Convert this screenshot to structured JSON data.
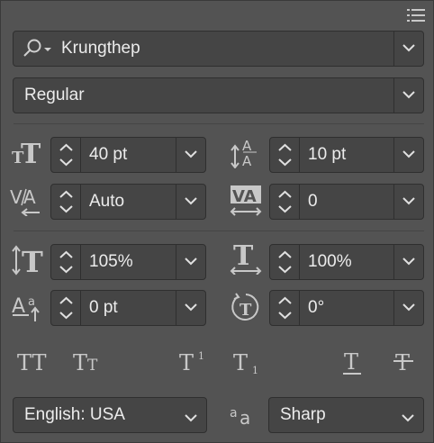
{
  "font_family": {
    "value": "Krungthep"
  },
  "font_style": {
    "value": "Regular"
  },
  "size": {
    "value": "40 pt"
  },
  "leading": {
    "value": "10 pt"
  },
  "kerning": {
    "value": "Auto"
  },
  "tracking": {
    "value": "0"
  },
  "vertical_scale": {
    "value": "105%"
  },
  "horizontal_scale": {
    "value": "100%"
  },
  "baseline_shift": {
    "value": "0 pt"
  },
  "rotation": {
    "value": "0°"
  },
  "language": {
    "value": "English: USA"
  },
  "antialiasing": {
    "value": "Sharp"
  },
  "colors": {
    "panel_bg": "#535353",
    "field_bg": "#454545",
    "border": "#2f2f2f",
    "text": "#ececec",
    "icon": "#c8c8c8"
  }
}
